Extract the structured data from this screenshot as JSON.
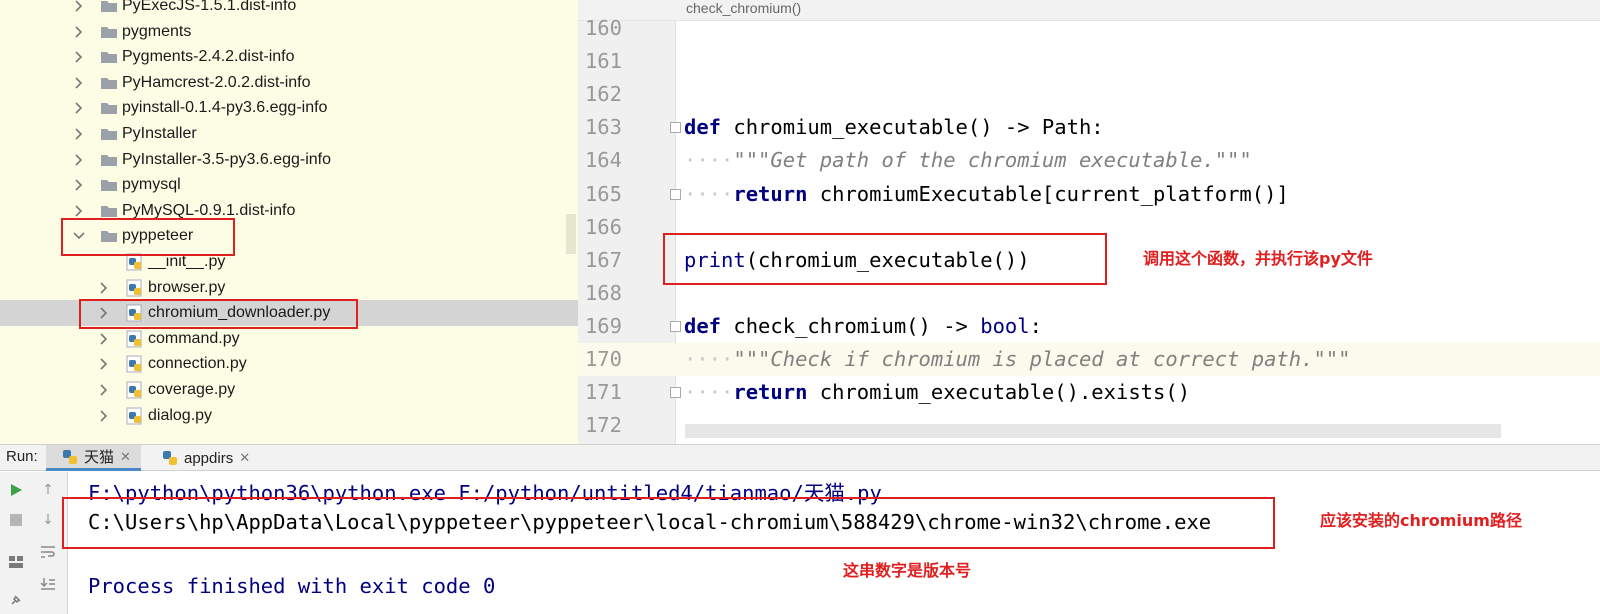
{
  "tree": {
    "items": [
      {
        "label": "PyExecJS-1.5.1.dist-info",
        "type": "folder",
        "depth": 1
      },
      {
        "label": "pygments",
        "type": "folder",
        "depth": 1
      },
      {
        "label": "Pygments-2.4.2.dist-info",
        "type": "folder",
        "depth": 1
      },
      {
        "label": "PyHamcrest-2.0.2.dist-info",
        "type": "folder",
        "depth": 1
      },
      {
        "label": "pyinstall-0.1.4-py3.6.egg-info",
        "type": "folder",
        "depth": 1
      },
      {
        "label": "PyInstaller",
        "type": "folder",
        "depth": 1
      },
      {
        "label": "PyInstaller-3.5-py3.6.egg-info",
        "type": "folder",
        "depth": 1
      },
      {
        "label": "pymysql",
        "type": "folder",
        "depth": 1
      },
      {
        "label": "PyMySQL-0.9.1.dist-info",
        "type": "folder",
        "depth": 1
      },
      {
        "label": "pyppeteer",
        "type": "folder",
        "depth": 1,
        "expanded": true
      },
      {
        "label": "__init__.py",
        "type": "pyfile",
        "depth": 2
      },
      {
        "label": "browser.py",
        "type": "pyfile",
        "depth": 2
      },
      {
        "label": "chromium_downloader.py",
        "type": "pyfile",
        "depth": 2,
        "selected": true
      },
      {
        "label": "command.py",
        "type": "pyfile",
        "depth": 2
      },
      {
        "label": "connection.py",
        "type": "pyfile",
        "depth": 2
      },
      {
        "label": "coverage.py",
        "type": "pyfile",
        "depth": 2
      },
      {
        "label": "dialog.py",
        "type": "pyfile",
        "depth": 2
      }
    ]
  },
  "editor": {
    "breadcrumb": "check_chromium()",
    "lines": [
      {
        "num": "160",
        "parts": []
      },
      {
        "num": "161",
        "parts": []
      },
      {
        "num": "162",
        "parts": []
      },
      {
        "num": "163",
        "fold": true,
        "parts": [
          {
            "t": "def",
            "c": "kw"
          },
          {
            "t": " chromium_executable() ",
            "c": ""
          },
          {
            "t": "->",
            "c": ""
          },
          {
            "t": " Path:",
            "c": ""
          }
        ]
      },
      {
        "num": "164",
        "parts": [
          {
            "t": "····",
            "c": "ws"
          },
          {
            "t": "\"\"\"Get path of the chromium executable.\"\"\"",
            "c": "doc"
          }
        ]
      },
      {
        "num": "165",
        "fold": true,
        "parts": [
          {
            "t": "····",
            "c": "ws"
          },
          {
            "t": "return",
            "c": "kw"
          },
          {
            "t": " chromiumExecutable[current_platform()]",
            "c": ""
          }
        ]
      },
      {
        "num": "166",
        "parts": []
      },
      {
        "num": "167",
        "parts": [
          {
            "t": "print",
            "c": "bi"
          },
          {
            "t": "(chromium_executable())",
            "c": ""
          }
        ]
      },
      {
        "num": "168",
        "parts": []
      },
      {
        "num": "169",
        "fold": true,
        "parts": [
          {
            "t": "def",
            "c": "kw"
          },
          {
            "t": " check_chromium() ",
            "c": ""
          },
          {
            "t": "->",
            "c": ""
          },
          {
            "t": " ",
            "c": ""
          },
          {
            "t": "bool",
            "c": "bi"
          },
          {
            "t": ":",
            "c": ""
          }
        ]
      },
      {
        "num": "170",
        "caret": true,
        "parts": [
          {
            "t": "····",
            "c": "ws"
          },
          {
            "t": "\"\"\"Check if chromium is placed at correct path.\"\"\"",
            "c": "doc"
          }
        ]
      },
      {
        "num": "171",
        "fold": true,
        "parts": [
          {
            "t": "····",
            "c": "ws"
          },
          {
            "t": "return",
            "c": "kw"
          },
          {
            "t": " chromium_executable().exists()",
            "c": ""
          }
        ]
      },
      {
        "num": "172",
        "parts": []
      }
    ]
  },
  "run": {
    "label": "Run:",
    "tabs": [
      {
        "label": "天猫",
        "active": true
      },
      {
        "label": "appdirs",
        "active": false
      }
    ],
    "console": {
      "command": "F:\\python\\python36\\python.exe F:/python/untitled4/tianmao/天猫.py",
      "result": "C:\\Users\\hp\\AppData\\Local\\pyppeteer\\pyppeteer\\local-chromium\\588429\\chrome-win32\\chrome.exe",
      "finished": "Process finished with exit code 0"
    }
  },
  "annotations": {
    "call_note": "调用这个函数，并执行该py文件",
    "path_note": "应该安装的chromium路径",
    "version_note": "这串数字是版本号",
    "color": "#e02020"
  }
}
